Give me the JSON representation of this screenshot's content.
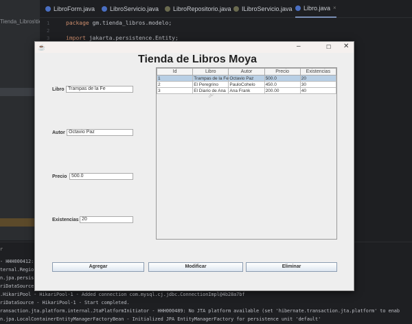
{
  "ide": {
    "tabs": [
      {
        "label": "LibroForm.java"
      },
      {
        "label": "LibroServicio.java"
      },
      {
        "label": "LibroRepositorio.java"
      },
      {
        "label": "ILibroServicio.java"
      },
      {
        "label": "Libro.java",
        "close": "×"
      }
    ],
    "project_path": "Tienda_Libros\\tienda",
    "code_lines": [
      {
        "num": "1",
        "kw": "package",
        "text": " gm.tienda_libros.modelo;"
      },
      {
        "num": "2",
        "kw": "",
        "text": ""
      },
      {
        "num": "3",
        "kw": "import",
        "text": " jakarta.persistence.Entity;"
      }
    ],
    "console_header": "r",
    "console_lines": [
      "- HHH000412:",
      "ternal.Regio",
      "n.jpa.persis",
      "riDataSource",
      ".HikariPool - HikariPool-1 - Added connection com.mysql.cj.jdbc.ConnectionImpl@4b28a7bf",
      "riDataSource - HikariPool-1 - Start completed.",
      "ransaction.jta.platform.internal.JtaPlatformInitiator - HHH000489: No JTA platform available (set 'hibernate.transaction.jta.platform' to enab",
      "n.jpa.LocalContainerEntityManagerFactoryBean - Initialized JPA EntityManagerFactory for persistence unit 'default'"
    ]
  },
  "window": {
    "controls": {
      "minimize": "–",
      "maximize": "☐",
      "close": "✕"
    },
    "title": "Tienda de Libros Moya",
    "form": {
      "libro_label": "Libro",
      "libro_value": "Trampas de la Fe",
      "autor_label": "Autor",
      "autor_value": "Octavio Paz",
      "precio_label": "Precio",
      "precio_value": "500.0",
      "existencias_label": "Existencias",
      "existencias_value": "20"
    },
    "table": {
      "columns": [
        "Id",
        "Libro",
        "Autor",
        "Precio",
        "Existencias"
      ],
      "rows": [
        [
          "1",
          "Trampas de la Fe",
          "Octavio Paz",
          "500.0",
          "20"
        ],
        [
          "2",
          "El Peregrino",
          "PauloCohelo",
          "450.0",
          "30"
        ],
        [
          "3",
          "El Diario de Ana",
          "Ana Frank",
          "200.00",
          "40"
        ]
      ],
      "selected_row": 0
    },
    "buttons": {
      "add": "Agregar",
      "modify": "Modificar",
      "delete": "Eliminar"
    }
  }
}
